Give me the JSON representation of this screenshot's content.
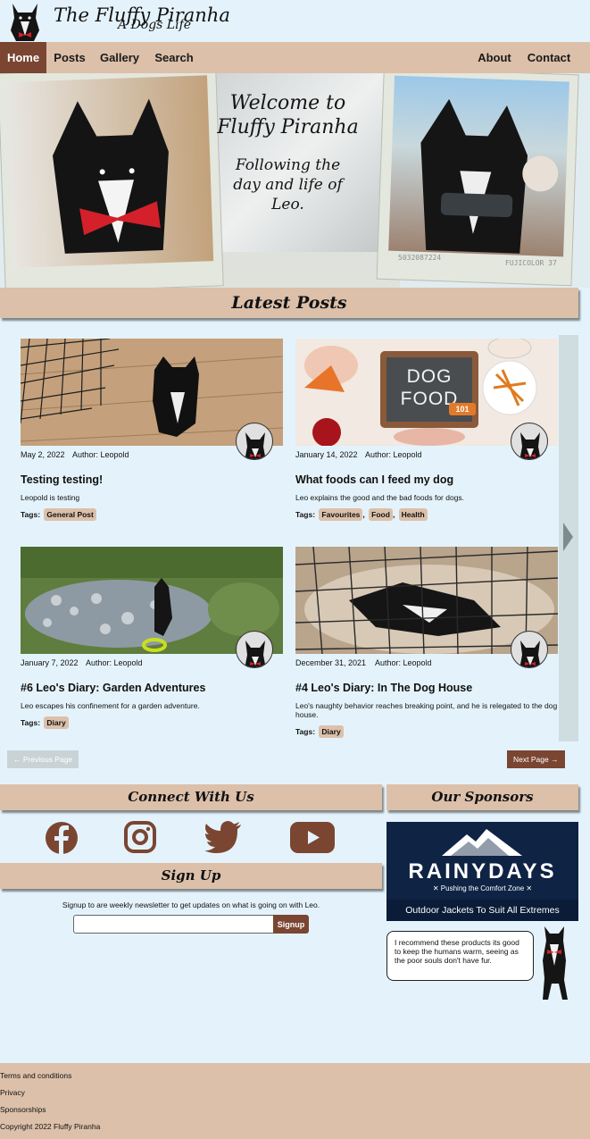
{
  "site": {
    "title": "The Fluffy Piranha",
    "subtitle": "A Dogs Life"
  },
  "nav": {
    "left": [
      {
        "label": "Home",
        "active": true
      },
      {
        "label": "Posts"
      },
      {
        "label": "Gallery"
      },
      {
        "label": "Search"
      }
    ],
    "right": [
      {
        "label": "About"
      },
      {
        "label": "Contact"
      }
    ]
  },
  "hero": {
    "welcome_line1": "Welcome to",
    "welcome_line2": "Fluffy Piranha",
    "tagline_line1": "Following the",
    "tagline_line2": "day and life of",
    "tagline_line3": "Leo.",
    "photo_stamp_left": "5032087224",
    "photo_stamp_right": "FUJICOLOR 37"
  },
  "latest_posts": {
    "heading": "Latest Posts",
    "posts": [
      {
        "date": "May 2, 2022",
        "author": "Author: Leopold",
        "title": "Testing testing!",
        "excerpt": "Leopold is testing",
        "tags_label": "Tags:",
        "tags": [
          "General Post"
        ]
      },
      {
        "date": "January 14, 2022",
        "author": "Author: Leopold",
        "title": "What foods can I feed my dog",
        "excerpt": "Leo explains the good and the bad foods for dogs.",
        "tags_label": "Tags:",
        "tags": [
          "Favourites",
          "Food",
          "Health"
        ],
        "image_text_line1": "DOG",
        "image_text_line2": "FOOD",
        "image_text_tag": "101"
      },
      {
        "date": "January 7, 2022",
        "author": "Author: Leopold",
        "title": "#6 Leo's Diary: Garden Adventures",
        "excerpt": "Leo escapes his confinement for a garden adventure.",
        "tags_label": "Tags:",
        "tags": [
          "Diary"
        ]
      },
      {
        "date": "December 31, 2021",
        "author": "Author: Leopold",
        "title": "#4 Leo's Diary: In The Dog House",
        "excerpt": "Leo's naughty behavior reaches breaking point, and he is relegated to the dog house.",
        "tags_label": "Tags:",
        "tags": [
          "Diary"
        ]
      }
    ],
    "prev_label": "← Previous Page",
    "next_label": "Next Page →"
  },
  "connect": {
    "heading": "Connect With Us",
    "icons": [
      "facebook-icon",
      "instagram-icon",
      "twitter-icon",
      "youtube-icon"
    ]
  },
  "signup": {
    "heading": "Sign Up",
    "text": "Signup to are weekly newsletter to get updates on what is going on with Leo.",
    "placeholder": "",
    "button": "Signup"
  },
  "sponsors": {
    "heading": "Our Sponsors",
    "ad_brand": "RAINYDAYS",
    "ad_tagline": "✕ Pushing the Comfort Zone ✕",
    "ad_footer": "Outdoor Jackets To Suit All Extremes",
    "bubble": "I recommend these products its good to keep the humans warm, seeing as the poor souls don't have fur."
  },
  "footer": {
    "links": [
      "Terms and conditions",
      "Privacy",
      "Sponsorships",
      "Copyright 2022 Fluffy Piranha"
    ]
  },
  "colors": {
    "tan": "#dcc0aa",
    "brown": "#7a4632",
    "background": "#e4f3fb",
    "navy": "#0f2344"
  }
}
